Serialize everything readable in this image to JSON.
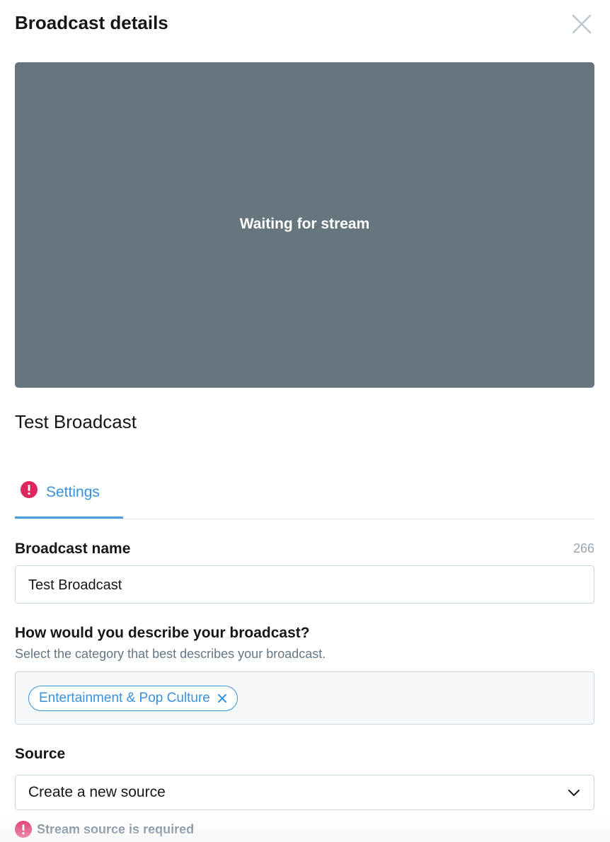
{
  "header": {
    "title": "Broadcast details",
    "close_icon": "close-icon"
  },
  "video": {
    "status_text": "Waiting for stream",
    "background_color": "#67757f"
  },
  "broadcast": {
    "title": "Test Broadcast"
  },
  "tabs": [
    {
      "label": "Settings",
      "icon": "alert-icon",
      "active": true
    }
  ],
  "form": {
    "name": {
      "label": "Broadcast name",
      "counter": "266",
      "value": "Test Broadcast"
    },
    "category": {
      "label": "How would you describe your broadcast?",
      "helper": "Select the category that best describes your broadcast.",
      "selected": [
        "Entertainment & Pop Culture"
      ],
      "remove_icon": "close-icon"
    },
    "source": {
      "label": "Source",
      "value": "Create a new source",
      "icon": "chevron-down-icon",
      "error": "Stream source is required",
      "error_icon": "alert-icon"
    }
  },
  "colors": {
    "accent": "#3a91dd",
    "error": "#e0245e",
    "muted": "#657786"
  }
}
